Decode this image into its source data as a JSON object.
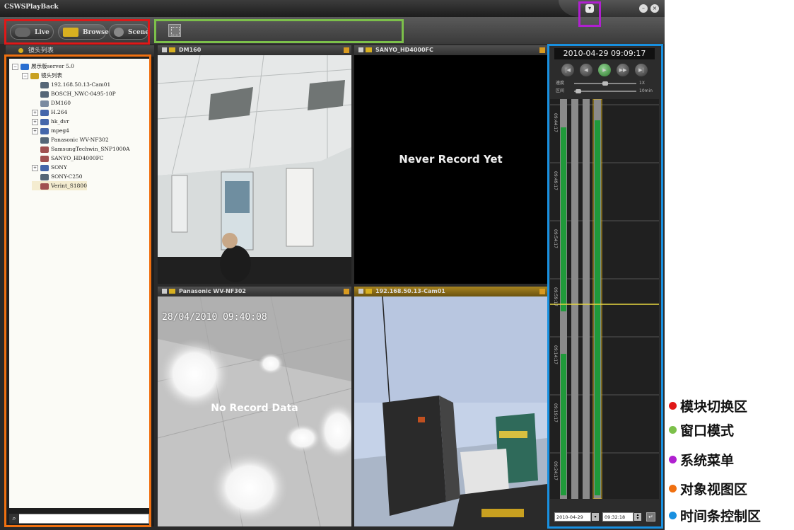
{
  "app": {
    "title": "CSWSPlayBack"
  },
  "modes": [
    {
      "label": "Live"
    },
    {
      "label": "Browse"
    },
    {
      "label": "Scene"
    }
  ],
  "left": {
    "title": "镜头列表"
  },
  "tree": [
    {
      "label": "展示版server 5.0",
      "level": 0,
      "expander": "−",
      "icon": "globe-icon",
      "color": "#2a6fd0"
    },
    {
      "label": "镜头列表",
      "level": 1,
      "expander": "−",
      "icon": "group-icon",
      "color": "#c8a020"
    },
    {
      "label": "192.168.50.13-Cam01",
      "level": 2,
      "icon": "camera-icon",
      "color": "#556677"
    },
    {
      "label": "BOSCH_NWC-0495-10P",
      "level": 2,
      "icon": "camera-icon",
      "color": "#556677"
    },
    {
      "label": "DM160",
      "level": 2,
      "icon": "dome-camera-icon",
      "color": "#7a8aa0"
    },
    {
      "label": "H.264",
      "level": 2,
      "expander": "+",
      "icon": "device-icon",
      "color": "#4466aa"
    },
    {
      "label": "hk_dvr",
      "level": 2,
      "expander": "+",
      "icon": "device-icon",
      "color": "#4466aa"
    },
    {
      "label": "mpeg4",
      "level": 2,
      "expander": "+",
      "icon": "device-icon",
      "color": "#4466aa"
    },
    {
      "label": "Panasonic WV-NF302",
      "level": 2,
      "icon": "camera-icon",
      "color": "#556677"
    },
    {
      "label": "SamsungTechwin_SNP1000A",
      "level": 2,
      "icon": "dome-camera-icon",
      "color": "#a05050"
    },
    {
      "label": "SANYO_HD4000FC",
      "level": 2,
      "icon": "dome-camera-icon",
      "color": "#a05050"
    },
    {
      "label": "SONY",
      "level": 2,
      "expander": "+",
      "icon": "device-icon",
      "color": "#4466aa"
    },
    {
      "label": "SONY-C250",
      "level": 2,
      "icon": "camera-icon",
      "color": "#556677"
    },
    {
      "label": "Verint_S1800",
      "level": 2,
      "icon": "dome-camera-icon",
      "color": "#a05050",
      "selected": true
    }
  ],
  "panels": [
    {
      "title": "DM160",
      "overlay": ""
    },
    {
      "title": "SANYO_HD4000FC",
      "overlay": "Never Record Yet"
    },
    {
      "title": "Panasonic WV-NF302",
      "overlay": "No Record Data",
      "timestamp": "28/04/2010 09:40:08"
    },
    {
      "title": "192.168.50.13-Cam01",
      "overlay": "",
      "active": true
    }
  ],
  "timebar": {
    "clock": "2010-04-29 09:09:17",
    "speed_label": "速度",
    "speed_value": "1X",
    "zoom_label": "区间",
    "zoom_value": "10min",
    "tick_labels": [
      "09:44:17",
      "09:49:17",
      "09:54:17",
      "09:59:17",
      "09:14:17",
      "09:19:17",
      "09:24:17",
      "09:34:17"
    ],
    "date_value": "2010-04-29",
    "time_value": "09:32:18"
  },
  "legend": [
    {
      "label": "模块切换区",
      "color": "#e01818"
    },
    {
      "label": "窗口模式",
      "color": "#7cc04a"
    },
    {
      "label": "系统菜单",
      "color": "#b020d0"
    },
    {
      "label": "对象视图区",
      "color": "#f07010"
    },
    {
      "label": "时间条控制区",
      "color": "#1890e0"
    }
  ],
  "highlight_colors": {
    "red": "#e01818",
    "green": "#7cc04a",
    "purple": "#b020d0",
    "orange": "#f07010",
    "blue": "#1890e0"
  }
}
